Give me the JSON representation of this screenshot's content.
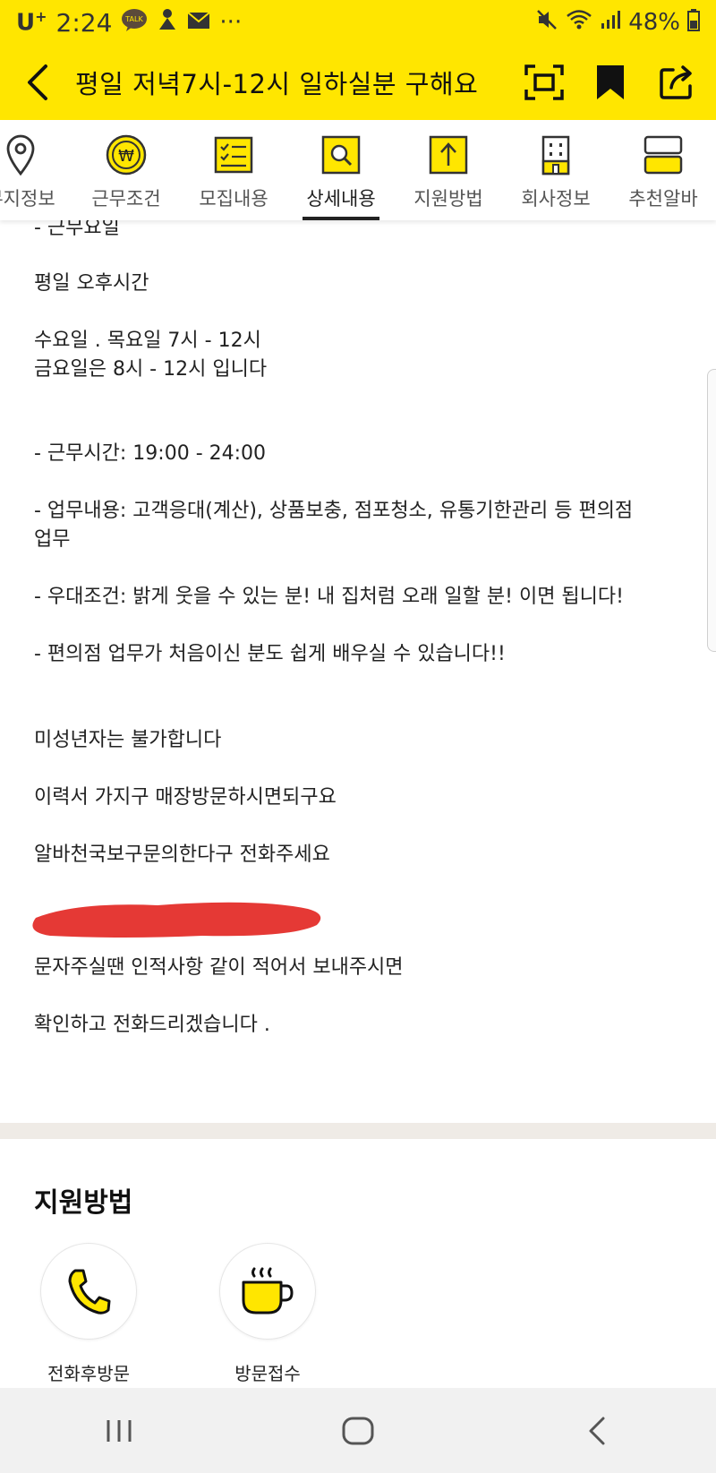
{
  "status_bar": {
    "carrier": "U",
    "carrier_sup": "+",
    "time": "2:24",
    "dots": "···",
    "battery": "48%"
  },
  "header": {
    "title": "평일 저녁7시-12시  일하실분  구해요"
  },
  "tabs": [
    {
      "label": "무지정보",
      "icon": "location-pin-icon"
    },
    {
      "label": "근무조건",
      "icon": "won-coin-icon"
    },
    {
      "label": "모집내용",
      "icon": "checklist-icon"
    },
    {
      "label": "상세내용",
      "icon": "magnifier-doc-icon",
      "active": true
    },
    {
      "label": "지원방법",
      "icon": "upload-doc-icon"
    },
    {
      "label": "회사정보",
      "icon": "building-icon"
    },
    {
      "label": "추천알바",
      "icon": "cards-icon"
    }
  ],
  "detail": {
    "line_0": "- 근무요일",
    "line_1": "평일 오후시간",
    "line_2": "수요일 . 목요일 7시 - 12시",
    "line_3": "금요일은 8시 - 12시 입니다",
    "line_4": "- 근무시간: 19:00 - 24:00",
    "line_5": "- 업무내용: 고객응대(계산), 상품보충, 점포청소, 유통기한관리 등 편의점",
    "line_6": "업무",
    "line_7": "- 우대조건: 밝게 웃을 수 있는 분! 내 집처럼 오래 일할 분! 이면 됩니다!",
    "line_8": "- 편의점 업무가 처음이신 분도 쉽게 배우실 수 있습니다!!",
    "line_9": "미성년자는 불가합니다",
    "line_10": "이력서 가지구 매장방문하시면되구요",
    "line_11": "알바천국보구문의한다구 전화주세요",
    "line_12": "문자주실땐 인적사항 같이 적어서 보내주시면",
    "line_13": "확인하고 전화드리겠습니다 ."
  },
  "apply_section": {
    "title": "지원방법",
    "items": [
      {
        "label": "전화후방문",
        "icon": "phone-icon"
      },
      {
        "label": "방문접수",
        "icon": "coffee-cup-icon"
      }
    ]
  },
  "colors": {
    "brand_yellow": "#ffe600",
    "redaction": "#e53935",
    "divider": "#efebe6"
  }
}
